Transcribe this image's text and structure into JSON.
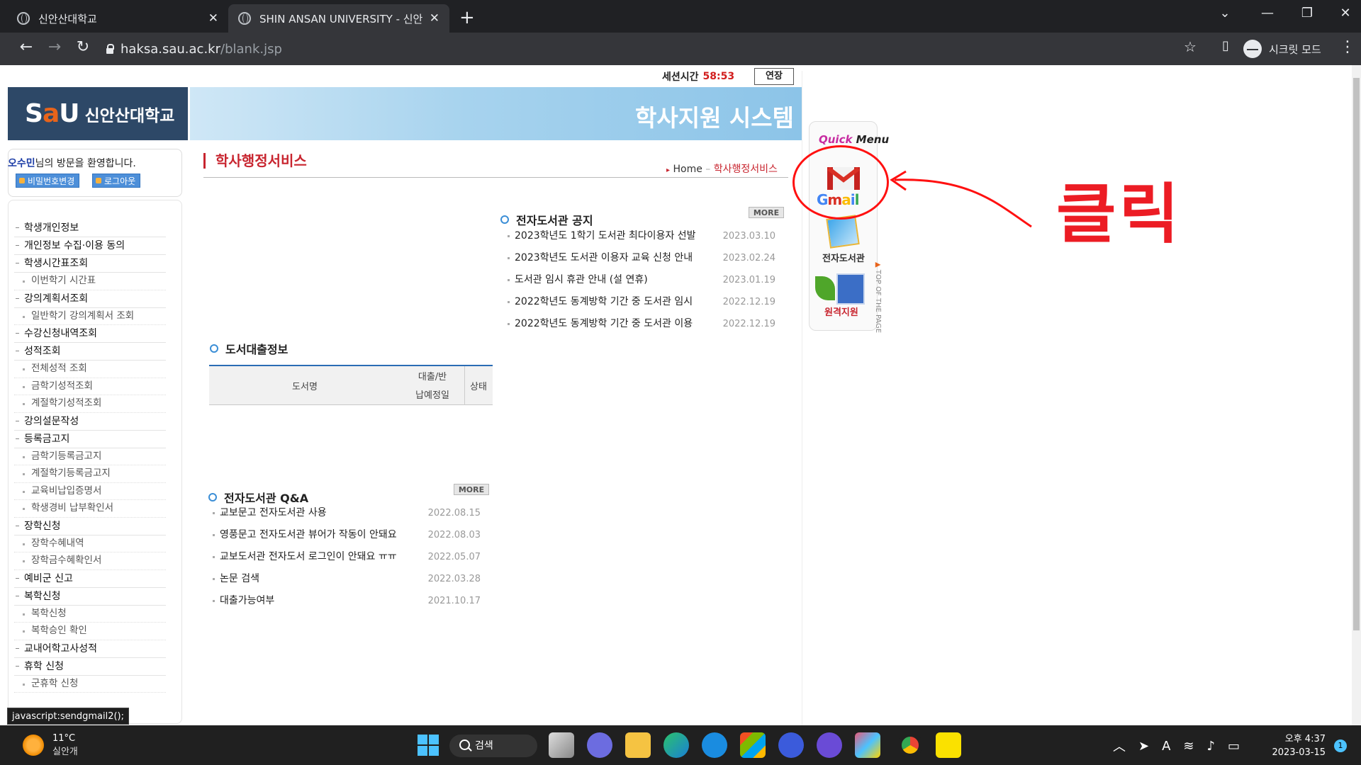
{
  "browser": {
    "tabs": [
      {
        "title": "신안산대학교",
        "active": false
      },
      {
        "title": "SHIN ANSAN UNIVERSITY - 신안",
        "active": true
      }
    ],
    "url_host": "haksa.sau.ac.kr",
    "url_path": "/blank.jsp",
    "incognito_label": "시크릿 모드",
    "status_tooltip": "javascript:sendgmail2();"
  },
  "header": {
    "session_label": "세션시간",
    "session_time": "58:53",
    "extend_label": "연장",
    "logo_mark_left": "S",
    "logo_mark_accent": "a",
    "logo_mark_right": "U",
    "logo_name": "신안산대학교",
    "banner_title": "학사지원 시스템"
  },
  "user": {
    "name": "오수민",
    "greeting": "님의 방문을 환영합니다.",
    "pw_button": "비밀번호변경",
    "logout_button": "로그아웃"
  },
  "menu": [
    {
      "label": "학생개인정보",
      "sub": false
    },
    {
      "label": "개인정보 수집·이용 동의",
      "sub": false
    },
    {
      "label": "학생시간표조회",
      "sub": false
    },
    {
      "label": "이번학기 시간표",
      "sub": true
    },
    {
      "label": "강의계획서조회",
      "sub": false
    },
    {
      "label": "일반학기 강의계획서 조회",
      "sub": true
    },
    {
      "label": "수강신청내역조회",
      "sub": false
    },
    {
      "label": "성적조회",
      "sub": false
    },
    {
      "label": "전체성적 조회",
      "sub": true
    },
    {
      "label": "금학기성적조회",
      "sub": true
    },
    {
      "label": "계절학기성적조회",
      "sub": true
    },
    {
      "label": "강의설문작성",
      "sub": false
    },
    {
      "label": "등록금고지",
      "sub": false
    },
    {
      "label": "금학기등록금고지",
      "sub": true
    },
    {
      "label": "계절학기등록금고지",
      "sub": true
    },
    {
      "label": "교육비납입증명서",
      "sub": true
    },
    {
      "label": "학생경비 납부확인서",
      "sub": true
    },
    {
      "label": "장학신청",
      "sub": false
    },
    {
      "label": "장학수혜내역",
      "sub": true
    },
    {
      "label": "장학금수혜확인서",
      "sub": true
    },
    {
      "label": "예비군 신고",
      "sub": false
    },
    {
      "label": "복학신청",
      "sub": false
    },
    {
      "label": "복학신청",
      "sub": true
    },
    {
      "label": "복학승인 확인",
      "sub": true
    },
    {
      "label": "교내어학고사성적",
      "sub": false
    },
    {
      "label": "휴학 신청",
      "sub": false
    },
    {
      "label": "군휴학 신청",
      "sub": true
    }
  ],
  "main": {
    "section_title": "학사행정서비스",
    "breadcrumb_home": "Home",
    "breadcrumb_current": "학사행정서비스",
    "library_notice": {
      "title": "전자도서관 공지",
      "more": "MORE",
      "items": [
        {
          "text": "2023학년도 1학기 도서관 최다이용자 선발",
          "date": "2023.03.10"
        },
        {
          "text": "2023학년도 도서관 이용자 교육 신청 안내",
          "date": "2023.02.24"
        },
        {
          "text": "도서관 임시 휴관 안내 (설 연휴)",
          "date": "2023.01.19"
        },
        {
          "text": "2022학년도 동계방학 기간 중 도서관 임시",
          "date": "2022.12.19"
        },
        {
          "text": "2022학년도 동계방학 기간 중 도서관 이용",
          "date": "2022.12.19"
        }
      ]
    },
    "loan": {
      "title": "도서대출정보",
      "col_book": "도서명",
      "col_date_top": "대출/반",
      "col_date_bottom": "납예정일",
      "col_status": "상태"
    },
    "qa": {
      "title": "전자도서관 Q&A",
      "more": "MORE",
      "items": [
        {
          "text": "교보문고 전자도서관 사용",
          "date": "2022.08.15"
        },
        {
          "text": "영풍문고 전자도서관 뷰어가 작동이 안돼요",
          "date": "2022.08.03"
        },
        {
          "text": "교보도서관 전자도서 로그인이 안돼요 ㅠㅠ",
          "date": "2022.05.07"
        },
        {
          "text": "논문 검색",
          "date": "2022.03.28"
        },
        {
          "text": "대출가능여부",
          "date": "2021.10.17"
        }
      ]
    }
  },
  "quick_menu": {
    "title_q": "Quick",
    "title_rest": " Menu",
    "gmail_g": "G",
    "gmail_m": "m",
    "gmail_a": "a",
    "gmail_i": "i",
    "gmail_l": "l",
    "elib_label": "전자도서관",
    "remote_label": "원격지원",
    "top_of_page": "TOP OF THE PAGE"
  },
  "annotation": {
    "text": "클릭",
    "color": "#ec1c24"
  },
  "taskbar": {
    "temperature": "11°C",
    "weather": "실안개",
    "search_label": "검색",
    "time": "오후 4:37",
    "date": "2023-03-15",
    "notification_count": "1"
  }
}
